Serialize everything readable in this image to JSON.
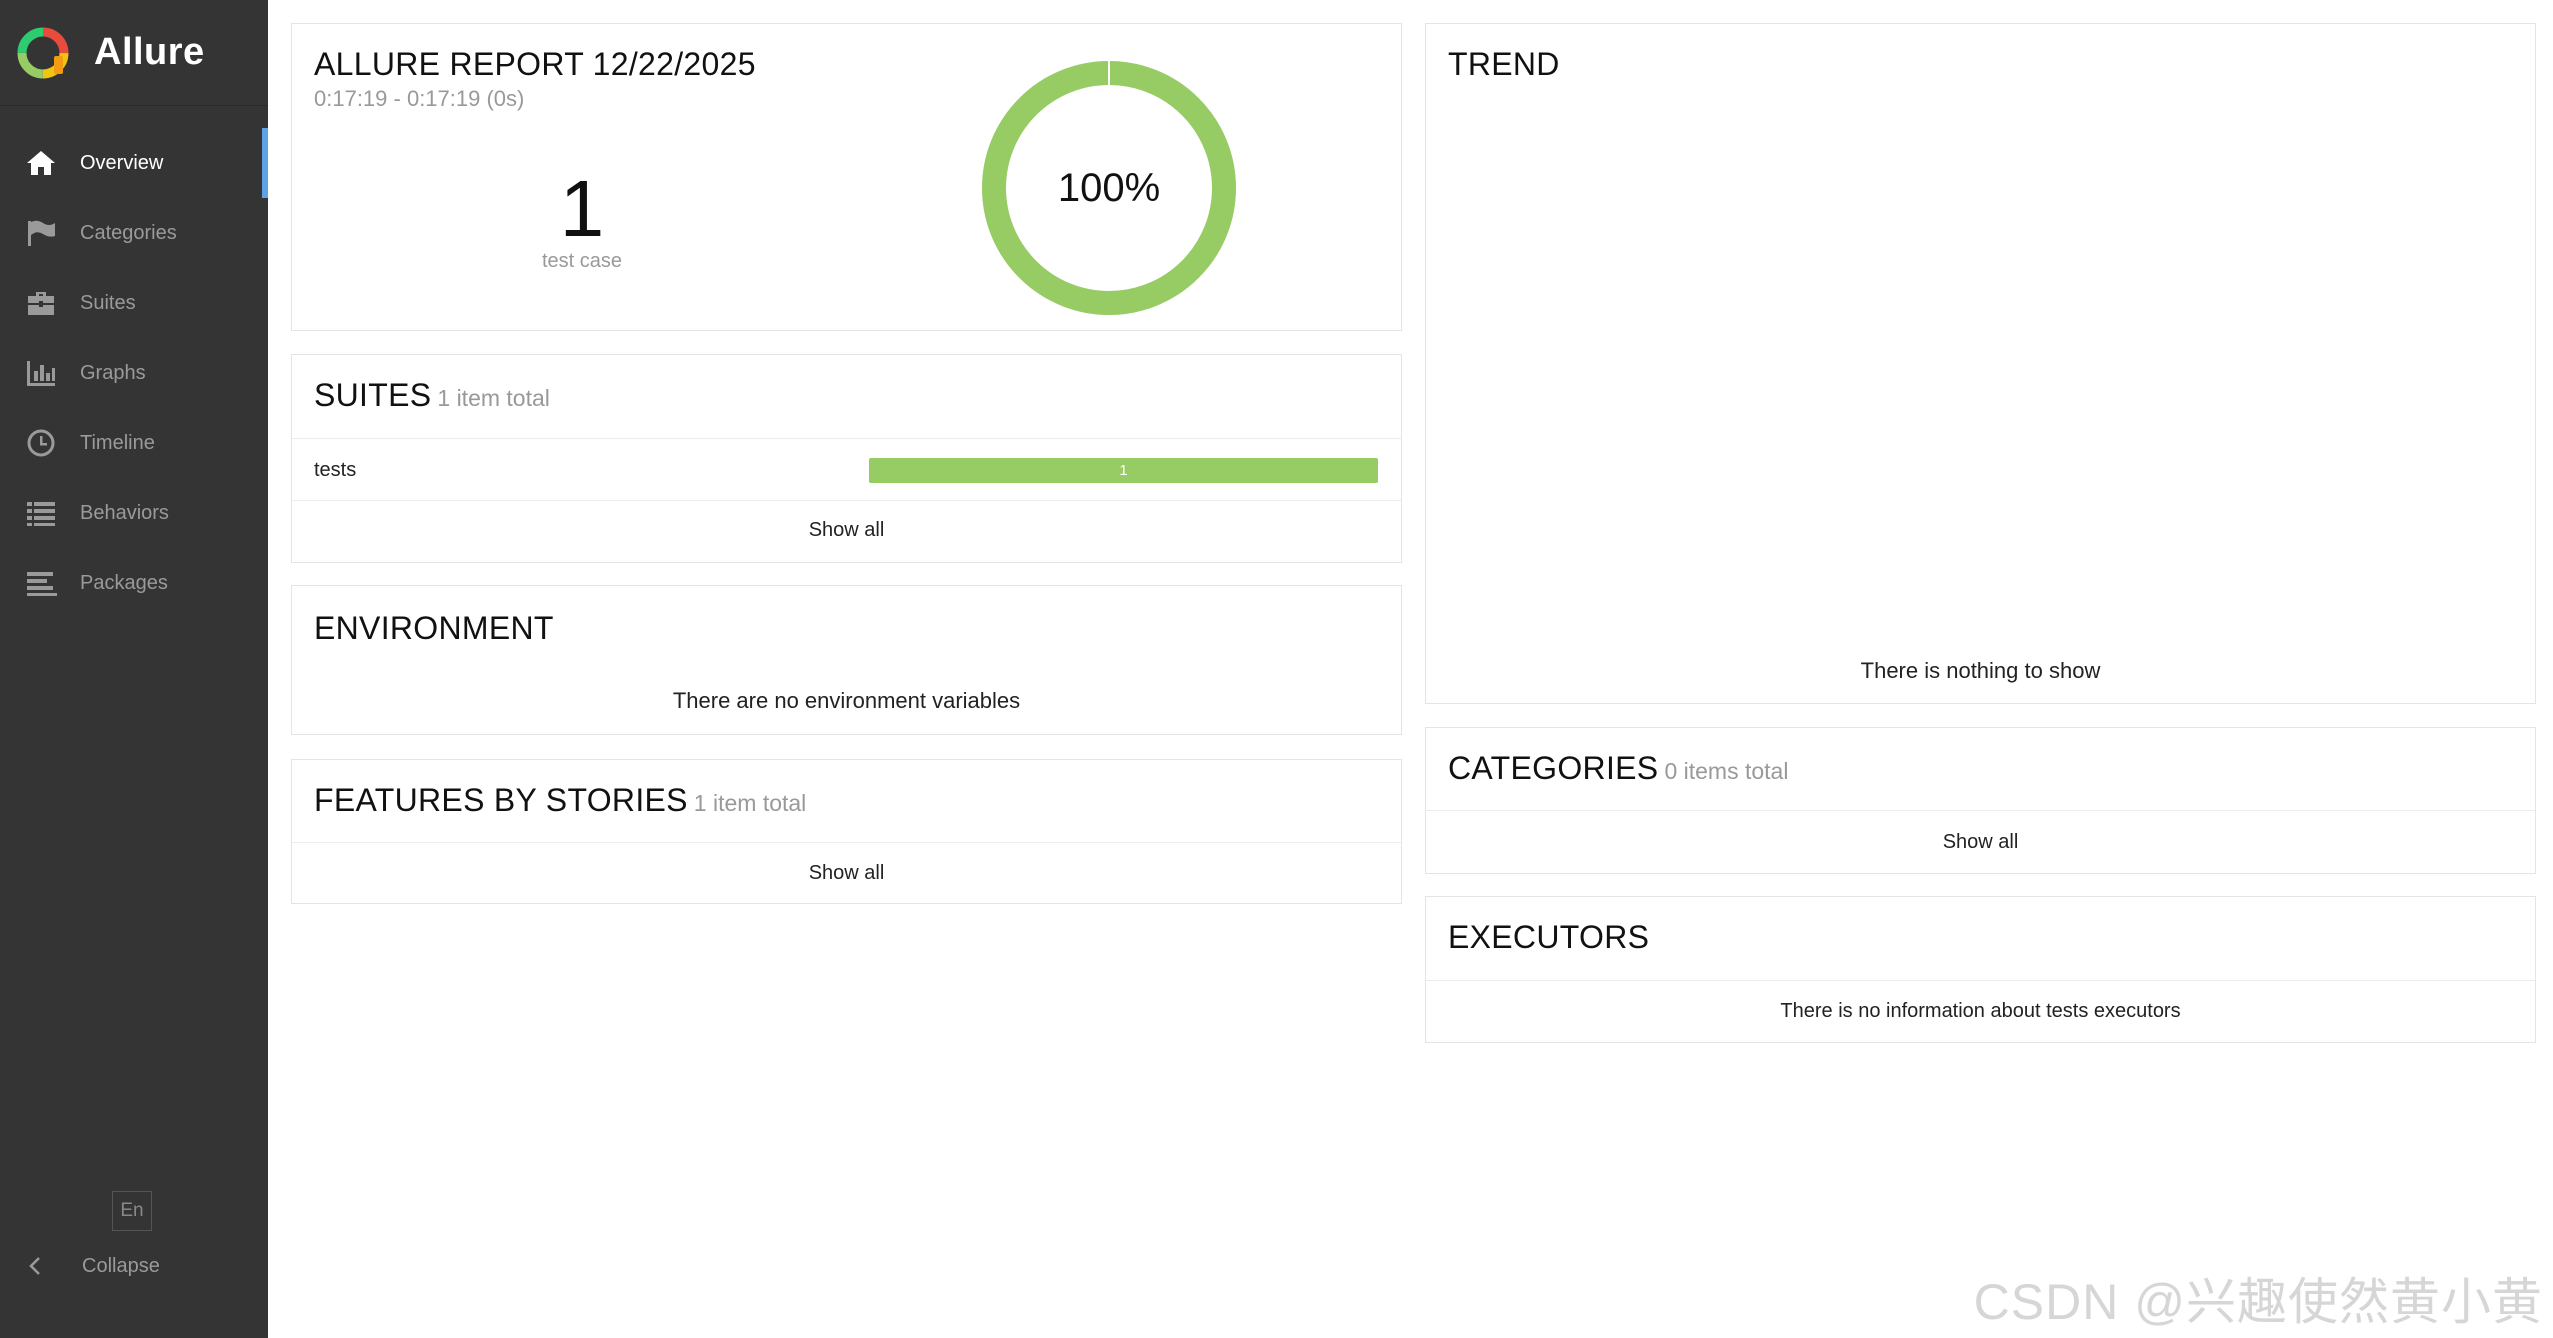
{
  "brand": {
    "name": "Allure"
  },
  "nav": [
    {
      "label": "Overview",
      "icon": "home-icon",
      "active": true
    },
    {
      "label": "Categories",
      "icon": "flag-icon"
    },
    {
      "label": "Suites",
      "icon": "briefcase-icon"
    },
    {
      "label": "Graphs",
      "icon": "bar-chart-icon"
    },
    {
      "label": "Timeline",
      "icon": "clock-icon"
    },
    {
      "label": "Behaviors",
      "icon": "list-icon"
    },
    {
      "label": "Packages",
      "icon": "align-left-icon"
    }
  ],
  "sidebar_footer": {
    "language": "En",
    "collapse_label": "Collapse"
  },
  "summary": {
    "title": "ALLURE REPORT 12/22/2025",
    "time_range": "0:17:19 - 0:17:19 (0s)",
    "count": "1",
    "count_label": "test case",
    "success_rate": "100%",
    "success_fraction": 1.0,
    "pass_color": "#97cc64"
  },
  "suites": {
    "title": "SUITES",
    "subtitle": "1 item total",
    "rows": [
      {
        "name": "tests",
        "passed": "1"
      }
    ],
    "show_all": "Show all"
  },
  "environment": {
    "title": "ENVIRONMENT",
    "empty_text": "There are no environment variables"
  },
  "features": {
    "title": "FEATURES BY STORIES",
    "subtitle": "1 item total",
    "show_all": "Show all"
  },
  "trend": {
    "title": "TREND",
    "empty_text": "There is nothing to show"
  },
  "categories": {
    "title": "CATEGORIES",
    "subtitle": "0 items total",
    "show_all": "Show all"
  },
  "executors": {
    "title": "EXECUTORS",
    "empty_text": "There is no information about tests executors"
  },
  "watermark": "CSDN @兴趣使然黄小黄"
}
